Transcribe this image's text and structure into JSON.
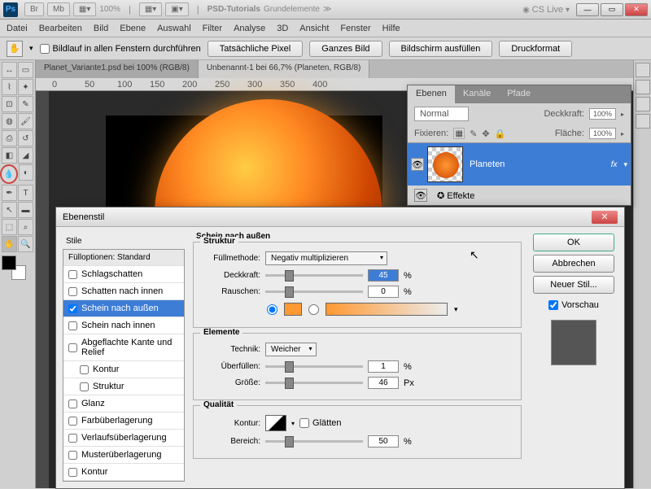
{
  "title": {
    "ps": "Ps",
    "br": "Br",
    "mb": "Mb",
    "zoom": "100%",
    "psd": "PSD-Tutorials",
    "grund": "Grundelemente",
    "cslive": "CS Live"
  },
  "menu": [
    "Datei",
    "Bearbeiten",
    "Bild",
    "Ebene",
    "Auswahl",
    "Filter",
    "Analyse",
    "3D",
    "Ansicht",
    "Fenster",
    "Hilfe"
  ],
  "optbar": {
    "scroll": "Bildlauf in allen Fenstern durchführen",
    "b1": "Tatsächliche Pixel",
    "b2": "Ganzes Bild",
    "b3": "Bildschirm ausfüllen",
    "b4": "Druckformat"
  },
  "tabs": {
    "t1": "Planet_Variante1.psd bei 100% (RGB/8)",
    "t2": "Unbenannt-1 bei 66,7% (Planeten, RGB/8)"
  },
  "ruler": {
    "r0": "0",
    "r1": "50",
    "r2": "100",
    "r3": "150",
    "r4": "200",
    "r5": "250",
    "r6": "300",
    "r7": "350",
    "r8": "400"
  },
  "layers": {
    "tabs": [
      "Ebenen",
      "Kanäle",
      "Pfade"
    ],
    "mode": "Normal",
    "opacity_lbl": "Deckkraft:",
    "opacity": "100%",
    "lock_lbl": "Fixieren:",
    "fill_lbl": "Fläche:",
    "fill": "100%",
    "name": "Planeten",
    "fx": "fx",
    "effects": "Effekte"
  },
  "dialog": {
    "title": "Ebenenstil",
    "styles_lbl": "Stile",
    "fill_opt": "Fülloptionen: Standard",
    "items": [
      "Schlagschatten",
      "Schatten nach innen",
      "Schein nach außen",
      "Schein nach innen",
      "Abgeflachte Kante und Relief",
      "Kontur",
      "Struktur",
      "Glanz",
      "Farbüberlagerung",
      "Verlaufsüberlagerung",
      "Musterüberlagerung",
      "Kontur"
    ],
    "section": "Schein nach außen",
    "struct": "Struktur",
    "blend_lbl": "Füllmethode:",
    "blend": "Negativ multiplizieren",
    "opacity_lbl": "Deckkraft:",
    "opacity": "45",
    "pct": "%",
    "noise_lbl": "Rauschen:",
    "noise": "0",
    "elements": "Elemente",
    "tech_lbl": "Technik:",
    "tech": "Weicher",
    "spread_lbl": "Überfüllen:",
    "spread": "1",
    "size_lbl": "Größe:",
    "size": "46",
    "px": "Px",
    "quality": "Qualität",
    "contour_lbl": "Kontur:",
    "aa": "Glätten",
    "range_lbl": "Bereich:",
    "range": "50",
    "ok": "OK",
    "cancel": "Abbrechen",
    "newstyle": "Neuer Stil...",
    "preview": "Vorschau"
  }
}
